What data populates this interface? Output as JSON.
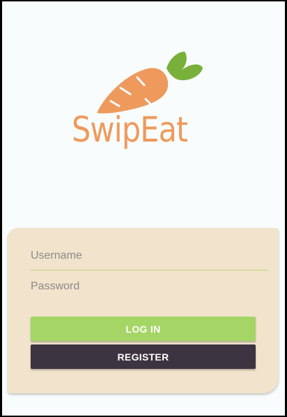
{
  "app": {
    "name": "SwipEat"
  },
  "login_form": {
    "username_placeholder": "Username",
    "password_placeholder": "Password",
    "login_label": "LOG IN",
    "register_label": "REGISTER"
  },
  "icons": {
    "logo": "carrot-icon"
  },
  "colors": {
    "screen_background": "#f8fcfc",
    "brand_orange": "#ee9a5d",
    "leaf_green": "#79b03a",
    "card_background": "#f2e3cc",
    "field_underline": "#b8d475",
    "login_button": "#a5d565",
    "register_button": "#3c3440"
  }
}
